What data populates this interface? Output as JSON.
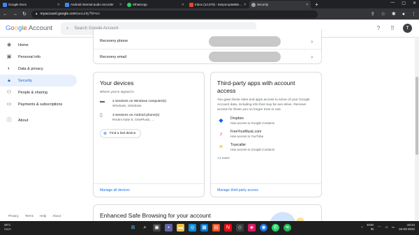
{
  "browser": {
    "tabs": [
      {
        "label": "Google Docs",
        "color": "#4285f4"
      },
      {
        "label": "Android internal audio recorder",
        "color": "#4285f4"
      },
      {
        "label": "WhatsApp",
        "color": "#25d366"
      },
      {
        "label": "Inbox (12,075) - tanipurupta656@...",
        "color": "#ea4335"
      },
      {
        "label": "Security",
        "color": "#9aa0a6"
      }
    ],
    "url_host": "myaccount.google.com",
    "url_path": "/security?hl=en"
  },
  "header": {
    "logo_google": "Google",
    "logo_account": "Account",
    "search_placeholder": "Search Google Account",
    "avatar_initial": "T"
  },
  "sidebar": {
    "items": [
      {
        "label": "Home",
        "icon": "home-icon"
      },
      {
        "label": "Personal info",
        "icon": "person-icon"
      },
      {
        "label": "Data & privacy",
        "icon": "toggle-icon"
      },
      {
        "label": "Security",
        "icon": "lock-icon"
      },
      {
        "label": "People & sharing",
        "icon": "people-icon"
      },
      {
        "label": "Payments & subscriptions",
        "icon": "card-icon"
      },
      {
        "label": "About",
        "icon": "info-icon"
      }
    ],
    "active_index": 3,
    "footer": [
      "Privacy",
      "Terms",
      "Help",
      "About"
    ]
  },
  "recovery": {
    "phone_label": "Recovery phone",
    "email_label": "Recovery email"
  },
  "devices": {
    "title": "Your devices",
    "subtitle": "Where you're signed in",
    "rows": [
      {
        "main": "2 sessions on Windows computer(s)",
        "sub": "Windows, Windows"
      },
      {
        "main": "3 sessions on Android phone(s)",
        "sub": "Redmi Note 8, OnePlus5, ..."
      }
    ],
    "find_button": "Find a lost device",
    "manage_link": "Manage all devices"
  },
  "third_party": {
    "title": "Third-party apps with account access",
    "description": "You gave these sites and apps access to some of your Google Account data, including info that may be sen-sitive. Remove access for those you no longer trust or use.",
    "apps": [
      {
        "name": "Dropbox",
        "access": "Has access to Google Contacts"
      },
      {
        "name": "FreeYourMusic.com",
        "access": "Has access to YouTube"
      },
      {
        "name": "Truecaller",
        "access": "Has access to Google Contacts"
      }
    ],
    "more": "+1 more",
    "manage_link": "Manage third-party access"
  },
  "safe_browsing": {
    "title": "Enhanced Safe Browsing for your account"
  },
  "taskbar": {
    "weather_temp": "29°C",
    "weather_desc": "Haze",
    "lang_top": "ENG",
    "lang_bottom": "IN",
    "time": "19:24",
    "date": "16-03-2022"
  }
}
